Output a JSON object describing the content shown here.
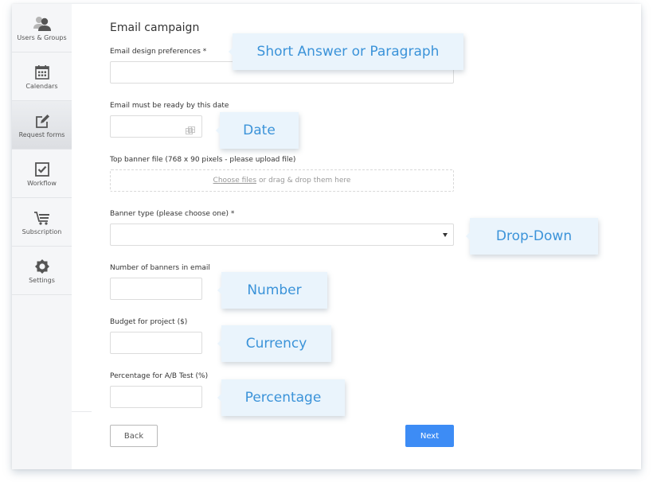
{
  "sidebar": {
    "items": [
      {
        "label": "Users & Groups",
        "icon": "users-icon",
        "active": false
      },
      {
        "label": "Calendars",
        "icon": "calendar-icon",
        "active": false
      },
      {
        "label": "Request forms",
        "icon": "edit-form-icon",
        "active": true
      },
      {
        "label": "Workflow",
        "icon": "checkbox-icon",
        "active": false
      },
      {
        "label": "Subscription",
        "icon": "cart-icon",
        "active": false
      },
      {
        "label": "Settings",
        "icon": "gear-icon",
        "active": false
      }
    ]
  },
  "form": {
    "title": "Email campaign",
    "fields": {
      "design_prefs": {
        "label": "Email design preferences *",
        "value": ""
      },
      "ready_date": {
        "label": "Email must be ready by this date",
        "value": "",
        "icon": "calendar-grid-icon"
      },
      "banner_file": {
        "label": "Top banner file (768 x 90 pixels - please upload file)",
        "choose_link": "Choose files",
        "drop_text": "or drag & drop them here"
      },
      "banner_type": {
        "label": "Banner type (please choose one) *",
        "selected": ""
      },
      "banner_count": {
        "label": "Number of banners in email",
        "value": ""
      },
      "budget": {
        "label": "Budget for project ($)",
        "value": ""
      },
      "ab_percentage": {
        "label": "Percentage for A/B Test (%)",
        "value": ""
      }
    },
    "buttons": {
      "back": "Back",
      "next": "Next"
    }
  },
  "callouts": {
    "short_answer": "Short Answer or Paragraph",
    "date": "Date",
    "dropdown": "Drop-Down",
    "number": "Number",
    "currency": "Currency",
    "percentage": "Percentage"
  },
  "colors": {
    "accent": "#3d8cf5",
    "callout_bg": "#eaf4fc",
    "callout_text": "#3b93d9",
    "sidebar_bg": "#f5f6f8"
  }
}
